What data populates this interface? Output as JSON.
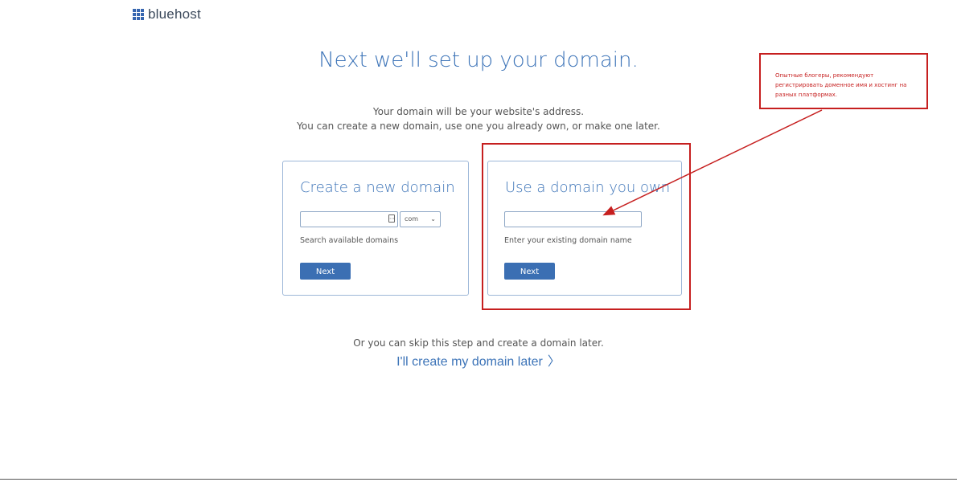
{
  "brand": {
    "name": "bluehost",
    "accent": "#3d74b8",
    "icon": "grid-logo-icon"
  },
  "header": {
    "title": "Next we'll set up your domain.",
    "subtitle_line1": "Your domain will be your website's address.",
    "subtitle_line2": "You can create a new domain, use one you already own, or make one later."
  },
  "new_domain": {
    "title": "Create a new domain",
    "input_value": "",
    "tld_selected": "com",
    "hint": "Search available domains",
    "button_label": "Next"
  },
  "own_domain": {
    "title": "Use a domain you own",
    "input_value": "",
    "hint": "Enter your existing domain name",
    "button_label": "Next"
  },
  "skip": {
    "text": "Or you can skip this step and create a domain later.",
    "link_label": "I'll create my domain later",
    "link_chevron": "〉"
  },
  "annotation": {
    "note": "Опытные блогеры, рекомендуют регистрировать доменное имя и хостинг на разных платформах.",
    "color": "#c61f1f"
  }
}
